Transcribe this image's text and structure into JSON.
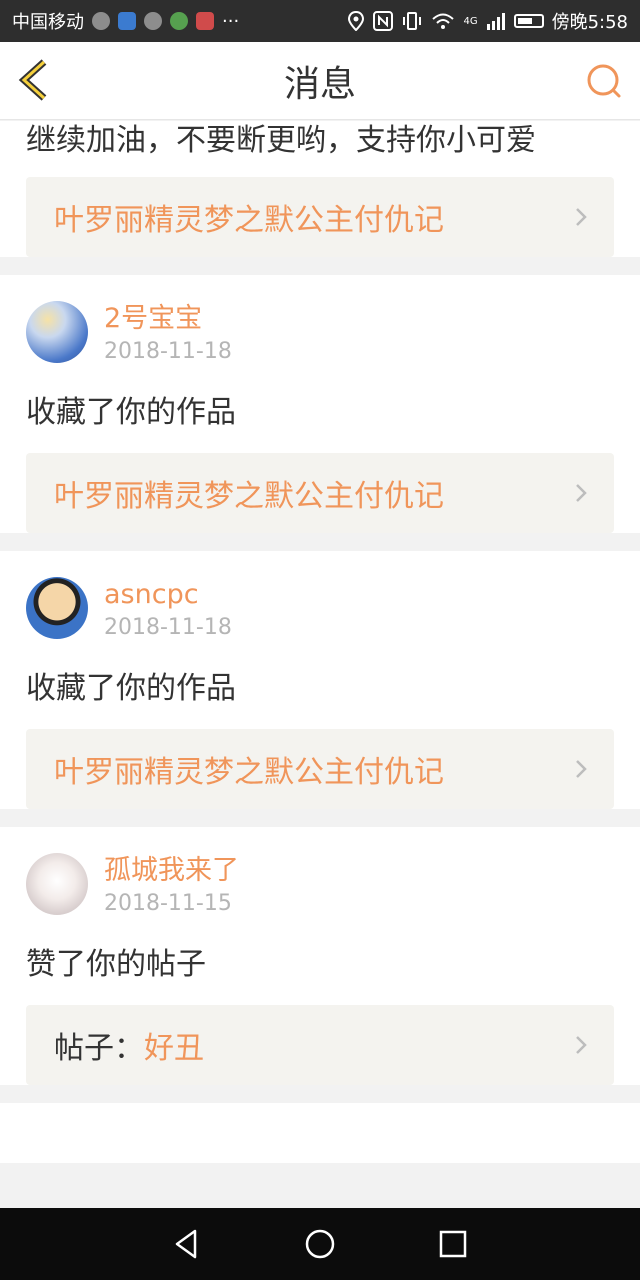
{
  "status_bar": {
    "carrier": "中国移动",
    "more": "···",
    "network": "4G",
    "time": "傍晚5:58"
  },
  "header": {
    "title": "消息",
    "back_icon": "chevron-left-icon",
    "search_icon": "search-icon"
  },
  "colors": {
    "accent": "#f0955a",
    "link_bg": "#f4f3ef",
    "text": "#333333",
    "date": "#b5b5b5"
  },
  "cards": [
    {
      "message": "继续加油，不要断更哟，支持你小可爱",
      "link_title": "叶罗丽精灵梦之默公主付仇记"
    },
    {
      "username": "2号宝宝",
      "date": "2018-11-18",
      "message": "收藏了你的作品",
      "link_title": "叶罗丽精灵梦之默公主付仇记"
    },
    {
      "username": "asncpc",
      "date": "2018-11-18",
      "message": "收藏了你的作品",
      "link_title": "叶罗丽精灵梦之默公主付仇记"
    },
    {
      "username": "孤城我来了",
      "date": "2018-11-15",
      "message": "赞了你的帖子",
      "link_prefix": "帖子：",
      "link_title": "好丑"
    }
  ],
  "nav": {
    "back": "back-triangle-icon",
    "home": "home-circle-icon",
    "recents": "recents-square-icon"
  }
}
